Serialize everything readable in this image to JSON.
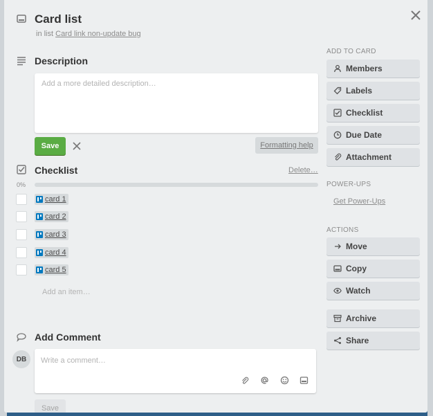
{
  "card": {
    "title": "Card list",
    "in_list_prefix": "in list",
    "list_name": "Card link non-update bug"
  },
  "description": {
    "heading": "Description",
    "placeholder": "Add a more detailed description…",
    "save_label": "Save",
    "formatting_help": "Formatting help"
  },
  "checklist": {
    "heading": "Checklist",
    "delete_label": "Delete…",
    "progress_label": "0%",
    "progress": 0,
    "items": [
      {
        "label": "card 1"
      },
      {
        "label": "card 2"
      },
      {
        "label": "card 3"
      },
      {
        "label": "card 4"
      },
      {
        "label": "card 5"
      }
    ],
    "add_item_placeholder": "Add an item…"
  },
  "comment": {
    "heading": "Add Comment",
    "avatar_initials": "DB",
    "placeholder": "Write a comment…",
    "save_label": "Save"
  },
  "sidebar": {
    "add_to_card_heading": "ADD TO CARD",
    "add_to_card": [
      {
        "label": "Members",
        "icon": "person-icon"
      },
      {
        "label": "Labels",
        "icon": "tag-icon"
      },
      {
        "label": "Checklist",
        "icon": "checkbox-icon"
      },
      {
        "label": "Due Date",
        "icon": "clock-icon"
      },
      {
        "label": "Attachment",
        "icon": "paperclip-icon"
      }
    ],
    "powerups_heading": "POWER-UPS",
    "powerups_link": "Get Power-Ups",
    "actions_heading": "ACTIONS",
    "actions": [
      {
        "label": "Move",
        "icon": "arrow-right-icon"
      },
      {
        "label": "Copy",
        "icon": "card-icon"
      },
      {
        "label": "Watch",
        "icon": "eye-icon"
      },
      {
        "label": "Archive",
        "icon": "archive-icon"
      },
      {
        "label": "Share",
        "icon": "share-icon"
      }
    ]
  },
  "colors": {
    "save_green": "#5aac44",
    "progress_blue": "#5ba4cf",
    "backdrop": "#2e5e88"
  }
}
